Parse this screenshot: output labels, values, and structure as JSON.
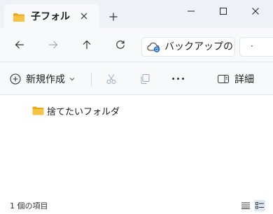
{
  "tab": {
    "title": "子フォルダ",
    "icon": "folder-icon"
  },
  "window": {
    "minimize_icon": "minimize-icon",
    "maximize_icon": "maximize-icon",
    "close_icon": "close-icon"
  },
  "address": {
    "text": "バックアップの",
    "icon": "cloud-sync-icon"
  },
  "search": {
    "label": "·"
  },
  "toolbar": {
    "new_label": "新規作成",
    "details_label": "詳細",
    "more_label": "•••"
  },
  "items": [
    {
      "name": "捨てたいフォルダ",
      "icon": "folder-icon"
    }
  ],
  "status": {
    "count_text": "1 個の項目"
  },
  "colors": {
    "folder": "#f6c344",
    "folder_dark": "#e8a820",
    "cloud_accent": "#1f6fcf",
    "titlebar_bg": "#eef1f6",
    "toolbar_bg": "#f8f9fb"
  }
}
